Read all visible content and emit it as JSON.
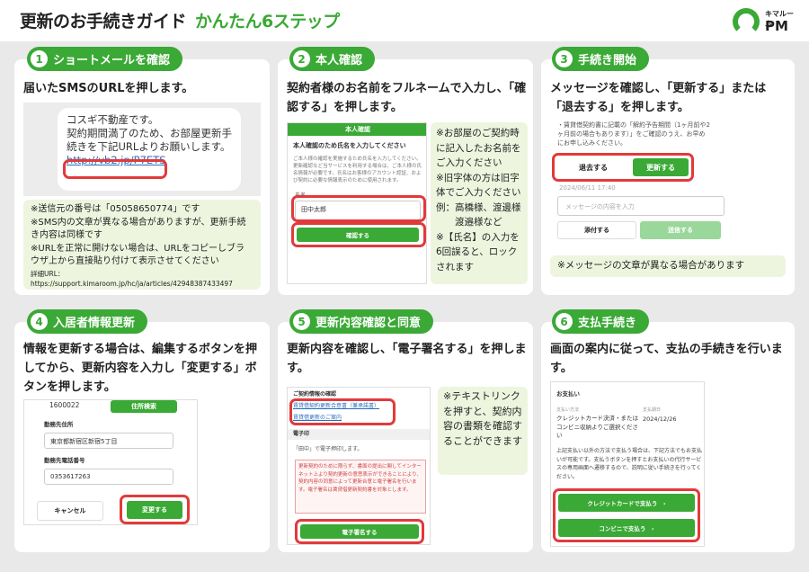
{
  "header": {
    "title": "更新のお手続きガイド",
    "subtitle": "かんたん6ステップ",
    "logo_small": "キマルーム",
    "logo_large": "PM"
  },
  "steps": [
    {
      "num": "1",
      "label": "ショートメールを確認",
      "heading": "届いたSMSのURLを押します。",
      "sms": {
        "text": "コスギ不動産です。\n契約期間満了のため、お部屋更新手続きを下記URLよりお願いします。",
        "url": "http://vb2.jp/P7ETS"
      },
      "notes": [
        "※送信元の番号は「05058650774」です",
        "※SMS内の文章が異なる場合がありますが、更新手続き内容は同様です",
        "※URLを正常に開けない場合は、URLをコピーしブラウザ上から直接貼り付けて表示させてください"
      ],
      "detail": "詳細URL：https://support.kimaroom.jp/hc/ja/articles/42948387433497"
    },
    {
      "num": "2",
      "label": "本人確認",
      "heading": "契約者様のお名前をフルネームで入力し、「確認する」を押します。",
      "screen": {
        "bar": "本人確認",
        "title": "本人確認のため氏名を入力してください",
        "body": "ご本人様の確認を実施するため氏名を入力してください。更新確認など当サービスを利用する場合は、ご本人様の氏名情報が必要です。氏名はお客様のアカウント認証、および契約に必要な情報表示のために使用されます。",
        "field_label": "氏名",
        "field_value": "田中太郎",
        "button": "確認する"
      },
      "note": "※お部屋のご契約時に記入したお名前をご入力ください\n※旧字体の方は旧字体でご入力ください\n例：高橋様、渡邊様\n　　渡邉様など\n※【氏名】の入力を6回誤ると、ロックされます"
    },
    {
      "num": "3",
      "label": "手続き開始",
      "heading": "メッセージを確認し、「更新する」または「退去する」を押します。",
      "screen": {
        "message": "・賃貸借契約書に記載の「解約予告期間（1ヶ月前や2ヶ月前の場合もあります）」をご確認のうえ、お早めにお申し込みください。",
        "leave_button": "退去する",
        "renew_button": "更新する",
        "timestamp": "2024/06/11 17:40",
        "input_placeholder": "メッセージの内容を入力",
        "attach_button": "添付する",
        "send_button": "送信する"
      },
      "note": "※メッセージの文章が異なる場合があります"
    },
    {
      "num": "4",
      "label": "入居者情報更新",
      "heading": "情報を更新する場合は、編集するボタンを押してから、更新内容を入力し「変更する」ボタンを押します。",
      "screen": {
        "postal": "1600022",
        "address_search": "住所検索",
        "work_address_label": "勤務先住所",
        "work_address": "東京都新宿区新宿5丁目",
        "work_phone_label": "勤務先電話番号",
        "work_phone": "0353617263",
        "cancel": "キャンセル",
        "change": "変更する"
      }
    },
    {
      "num": "5",
      "label": "更新内容確認と同意",
      "heading": "更新内容を確認し、「電子署名する」を押します。",
      "screen": {
        "section": "ご契約情報の確認",
        "link1": "賃貸借契約更新合意書（兼承諾書）",
        "link2": "賃貸借更新のご案内",
        "sign_title": "電子印",
        "sign_text": "「田中」で電子押印します。",
        "warning": "更新契約のために限らず、書面の提出に関してインターネット上より契約更新の意思表示ができることにより、契約内容の同意によって更新合意と電子署名を行います。電子署名は賃貸借更新契約書を対象とします。",
        "button": "電子署名する"
      },
      "note": "※テキストリンクを押すと、契約内容の書類を確認することができます"
    },
    {
      "num": "6",
      "label": "支払手続き",
      "heading": "画面の案内に従って、支払の手続きを行います。",
      "screen": {
        "title": "お支払い",
        "method_label": "支払い方法",
        "method": "クレジットカード決済・またはコンビニ収納よりご選択ください",
        "deadline_label": "支払期日",
        "deadline": "2024/12/26",
        "body": "上記支払い以外の方法で支払う場合は、下記方法でもお支払いが可能です。支払うボタンを押すとお支払いの代行サービスの専用画面へ遷移するので、説明に従い手続きを行ってください。",
        "card_button": "クレジットカードで支払う　›",
        "conv_button": "コンビニで支払う　›"
      }
    }
  ],
  "colors": {
    "green": "#3aa935",
    "red": "#e23a3a",
    "note_bg": "#eef5df"
  }
}
